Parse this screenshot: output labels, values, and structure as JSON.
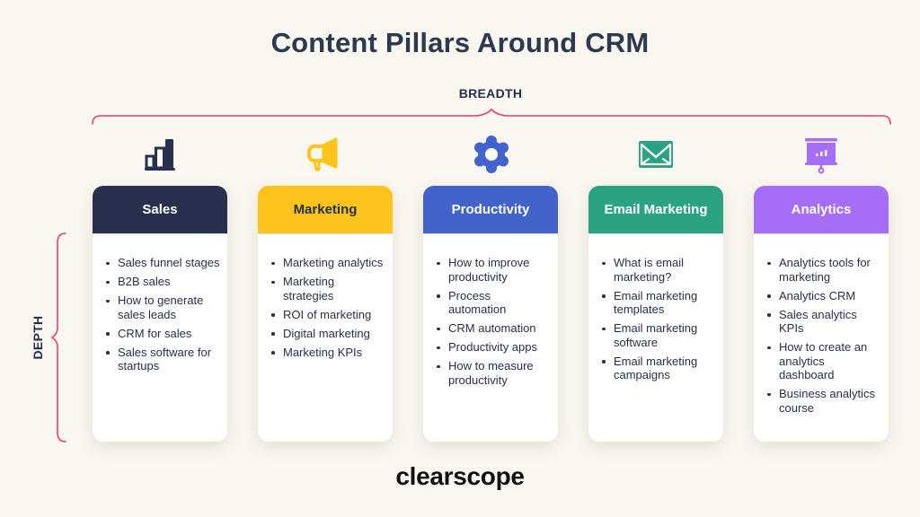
{
  "title": "Content Pillars Around CRM",
  "axes": {
    "breadth_label": "BREADTH",
    "depth_label": "DEPTH",
    "brace_color": "#e0436b"
  },
  "pillars": [
    {
      "name": "Sales",
      "icon": "bar-chart-icon",
      "color": "#27314d",
      "header_text_color": "#ffffff",
      "topics": [
        "Sales funnel stages",
        "B2B sales",
        "How to generate sales leads",
        "CRM for sales",
        "Sales software for startups"
      ]
    },
    {
      "name": "Marketing",
      "icon": "megaphone-icon",
      "color": "#fdc51b",
      "header_text_color": "#263048",
      "topics": [
        "Marketing analytics",
        "Marketing strategies",
        "ROI of marketing",
        "Digital marketing",
        "Marketing KPIs"
      ]
    },
    {
      "name": "Productivity",
      "icon": "gear-icon",
      "color": "#4263c9",
      "header_text_color": "#ffffff",
      "topics": [
        "How to improve productivity",
        "Process automation",
        "CRM automation",
        "Productivity apps",
        "How to measure productivity"
      ]
    },
    {
      "name": "Email Marketing",
      "icon": "envelope-icon",
      "color": "#2aa384",
      "header_text_color": "#ffffff",
      "topics": [
        "What is email marketing?",
        "Email marketing templates",
        "Email marketing software",
        "Email marketing campaigns"
      ]
    },
    {
      "name": "Analytics",
      "icon": "presentation-board-icon",
      "color": "#a66ef5",
      "header_text_color": "#ffffff",
      "topics": [
        "Analytics tools for marketing",
        "Analytics CRM",
        "Sales analytics KPIs",
        "How to create an analytics dashboard",
        "Business analytics course"
      ]
    }
  ],
  "footer": {
    "logo": "clearscope"
  }
}
